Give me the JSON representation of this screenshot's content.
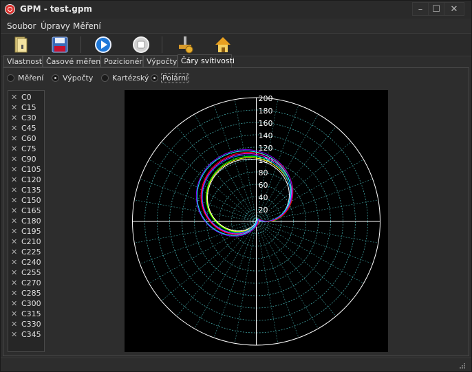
{
  "window": {
    "title": "GPM - test.gpm"
  },
  "menu": {
    "items": [
      "Soubor",
      "Úpravy",
      "Měření"
    ]
  },
  "tabs": [
    "Vlastnosti",
    "Časové měření",
    "Pozicionér",
    "Výpočty",
    "Čáry svítivosti"
  ],
  "view_options": [
    {
      "label": "Měření",
      "selected": false
    },
    {
      "label": "Výpočty",
      "selected": true
    },
    {
      "label": "Kartézský",
      "selected": false
    },
    {
      "label": "Polární",
      "selected": true
    }
  ],
  "curve_list": [
    "C0",
    "C15",
    "C30",
    "C45",
    "C60",
    "C75",
    "C90",
    "C105",
    "C120",
    "C135",
    "C150",
    "C165",
    "C180",
    "C195",
    "C210",
    "C225",
    "C240",
    "C255",
    "C270",
    "C285",
    "C300",
    "C315",
    "C330",
    "C345"
  ],
  "chart_data": {
    "type": "polar",
    "r_ticks": [
      "20",
      "40",
      "60",
      "80",
      "100",
      "120",
      "140",
      "160",
      "180",
      "200"
    ],
    "rlim": [
      0,
      200
    ],
    "grid": true,
    "background": "#000000",
    "series_colors": [
      "#ffffff",
      "#ffff00",
      "#00ff00",
      "#0080ff",
      "#ff00ff",
      "#ff0000",
      "#00ffff",
      "#8000ff"
    ]
  }
}
